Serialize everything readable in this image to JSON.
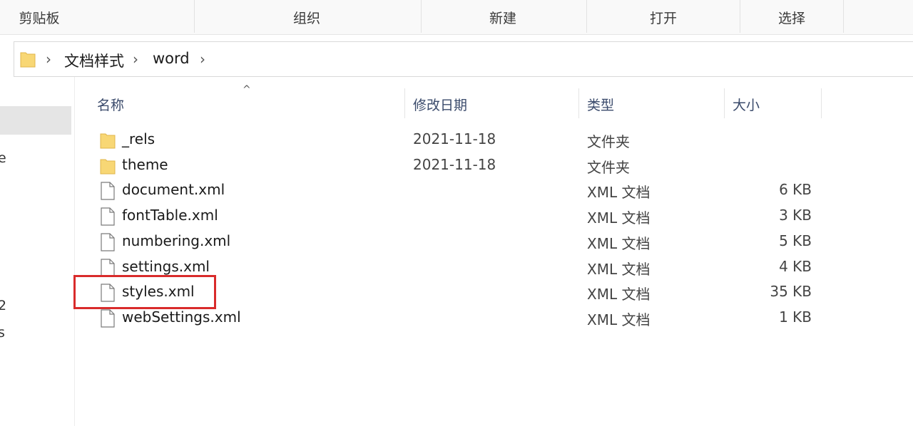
{
  "ribbon": {
    "groups": [
      "剪贴板",
      "组织",
      "新建",
      "打开",
      "选择"
    ]
  },
  "address": {
    "folder_icon": "folder-icon",
    "separator": "›",
    "crumbs": [
      "文档样式",
      "word"
    ]
  },
  "nav": {
    "fragments": [
      "e",
      "2",
      "s"
    ]
  },
  "columns": {
    "name": "名称",
    "date": "修改日期",
    "type": "类型",
    "size": "大小",
    "sort_indicator": "^"
  },
  "files": [
    {
      "name": "_rels",
      "date": "2021-11-18",
      "type": "文件夹",
      "size": "",
      "icon": "folder-icon"
    },
    {
      "name": "theme",
      "date": "2021-11-18",
      "type": "文件夹",
      "size": "",
      "icon": "folder-icon"
    },
    {
      "name": "document.xml",
      "date": "",
      "type": "XML 文档",
      "size": "6 KB",
      "icon": "file-icon"
    },
    {
      "name": "fontTable.xml",
      "date": "",
      "type": "XML 文档",
      "size": "3 KB",
      "icon": "file-icon"
    },
    {
      "name": "numbering.xml",
      "date": "",
      "type": "XML 文档",
      "size": "5 KB",
      "icon": "file-icon"
    },
    {
      "name": "settings.xml",
      "date": "",
      "type": "XML 文档",
      "size": "4 KB",
      "icon": "file-icon"
    },
    {
      "name": "styles.xml",
      "date": "",
      "type": "XML 文档",
      "size": "35 KB",
      "icon": "file-icon"
    },
    {
      "name": "webSettings.xml",
      "date": "",
      "type": "XML 文档",
      "size": "1 KB",
      "icon": "file-icon"
    }
  ],
  "colors": {
    "highlight": "#d92b2b",
    "folder": "#f8d775",
    "header_text": "#3a4a6b"
  }
}
